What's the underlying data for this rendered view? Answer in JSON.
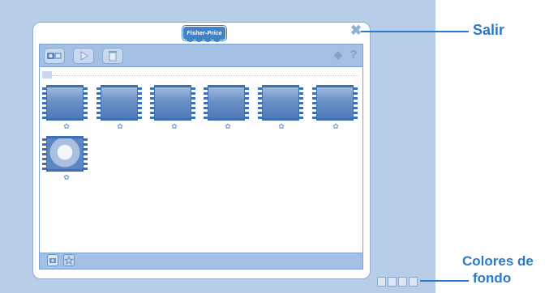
{
  "app": {
    "logo_text": "Fisher-Price"
  },
  "toolbar": {
    "buttons": [
      {
        "icon": "camera-switch-icon"
      },
      {
        "icon": "play-icon"
      },
      {
        "icon": "trash-icon"
      }
    ],
    "right_icons": [
      "volume-icon",
      "help-icon"
    ],
    "help_glyph": "?",
    "volume_glyph": "◈"
  },
  "gallery": {
    "folder_icon": "folder-icon",
    "items": [
      {
        "type": "video"
      },
      {
        "type": "video"
      },
      {
        "type": "video"
      },
      {
        "type": "video"
      },
      {
        "type": "video"
      },
      {
        "type": "video"
      },
      {
        "type": "video"
      }
    ],
    "star_glyph": "✿"
  },
  "bottombar": {
    "buttons": [
      {
        "icon": "camera-icon"
      },
      {
        "icon": "star-icon"
      }
    ]
  },
  "background_swatches": 4,
  "close_glyph": "✖",
  "labels": {
    "salir": "Salir",
    "colores_line1": "Colores de",
    "colores_line2": "fondo"
  },
  "colors": {
    "accent": "#2c79c9",
    "panel": "#a3bfe3",
    "background": "#b8cde8"
  }
}
